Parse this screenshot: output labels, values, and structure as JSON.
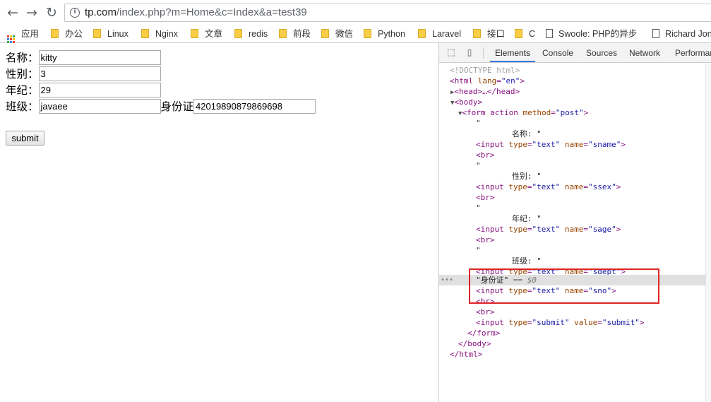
{
  "browser": {
    "url_host": "tp.com",
    "url_path": "/index.php?m=Home&c=Index&a=test39",
    "bookmarks": [
      "应用",
      "办公",
      "Linux",
      "Nginx",
      "文章",
      "redis",
      "前段",
      "微信",
      "Python",
      "Laravel",
      "接口",
      "C",
      "Swoole: PHP的异步",
      "Richard Jon"
    ]
  },
  "form": {
    "name_label": "名称：",
    "name_value": "kitty",
    "sex_label": "性别：",
    "sex_value": "3",
    "age_label": "年纪：",
    "age_value": "29",
    "dept_label": "班级：",
    "dept_value": "javaee",
    "sno_label": "身份证",
    "sno_value": "42019890879869698",
    "submit_label": "submit"
  },
  "devtools": {
    "tabs": [
      "Elements",
      "Console",
      "Sources",
      "Network",
      "Performan"
    ],
    "active_tab": "Elements",
    "lines": [
      "<!DOCTYPE html>",
      "<html lang=\"en\">",
      "<head>…</head>",
      "<body>",
      "<form action method=\"post\">",
      "\"",
      "名称: \"",
      "<input type=\"text\" name=\"sname\">",
      "<br>",
      "\"",
      "性别: \"",
      "<input type=\"text\" name=\"ssex\">",
      "<br>",
      "\"",
      "年纪: \"",
      "<input type=\"text\" name=\"sage\">",
      "<br>",
      "\"",
      "班级: \"",
      "<input type=\"text\" name=\"sdept\">",
      "\"身份证\" == $0",
      "<input type=\"text\" name=\"sno\">",
      "<br>",
      "<br>",
      "<input type=\"submit\" value=\"submit\">",
      "</form>",
      "</body>",
      "</html>"
    ]
  },
  "colors": {
    "highlight_box": "#e02424",
    "active_tab_underline": "#3879d9",
    "tag": "#881280",
    "attr_name": "#994500",
    "attr_value": "#1a1aa6"
  }
}
